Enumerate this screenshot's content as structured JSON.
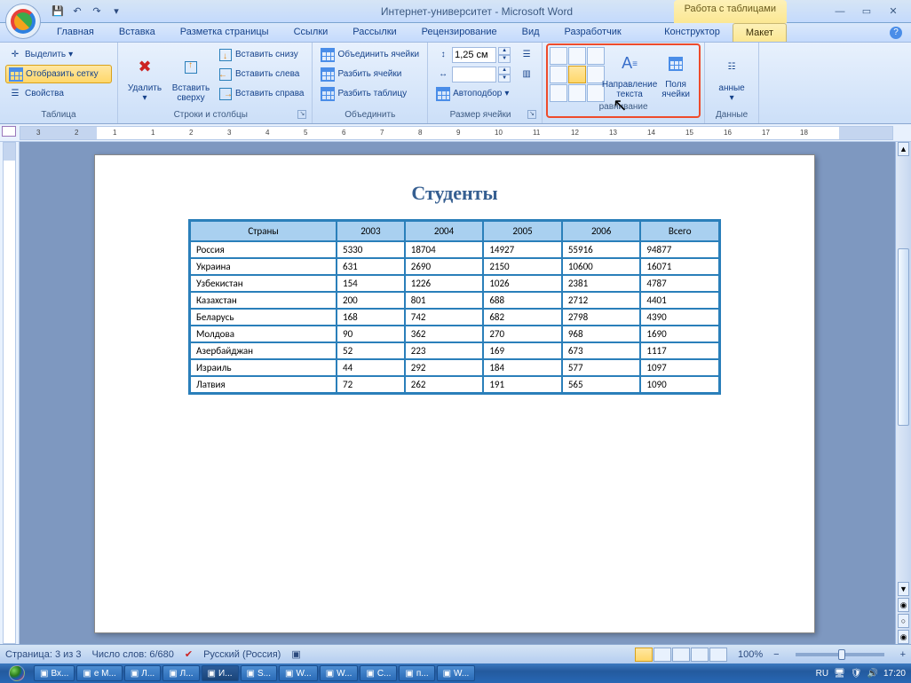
{
  "title": "Интернет-университет - Microsoft Word",
  "context_title": "Работа с таблицами",
  "tabs": [
    "Главная",
    "Вставка",
    "Разметка страницы",
    "Ссылки",
    "Рассылки",
    "Рецензирование",
    "Вид",
    "Разработчик"
  ],
  "context_tabs": [
    "Конструктор",
    "Макет"
  ],
  "active_context_tab": "Макет",
  "ribbon": {
    "table": {
      "label": "Таблица",
      "select": "Выделить",
      "grid": "Отобразить сетку",
      "props": "Свойства"
    },
    "rowscols": {
      "label": "Строки и столбцы",
      "delete": "Удалить",
      "insert_top": "Вставить сверху",
      "insert_bottom": "Вставить снизу",
      "insert_left": "Вставить слева",
      "insert_right": "Вставить справа"
    },
    "merge": {
      "label": "Объединить",
      "merge": "Объединить ячейки",
      "split": "Разбить ячейки",
      "split_table": "Разбить таблицу"
    },
    "cellsize": {
      "label": "Размер ячейки",
      "height": "1,25 см",
      "width": "",
      "autofit": "Автоподбор"
    },
    "align": {
      "label": "равнивание",
      "textdir": "Направление текста",
      "margins": "Поля ячейки"
    },
    "data": {
      "label": "Данные",
      "btn": "анные"
    }
  },
  "doc": {
    "title": "Студенты",
    "headers": [
      "Страны",
      "2003",
      "2004",
      "2005",
      "Всего"
    ],
    "header_mid": "2006",
    "rows": [
      [
        "Россия",
        "5330",
        "18704",
        "14927",
        "55916",
        "94877"
      ],
      [
        "Украина",
        "631",
        "2690",
        "2150",
        "10600",
        "16071"
      ],
      [
        "Узбекистан",
        "154",
        "1226",
        "1026",
        "2381",
        "4787"
      ],
      [
        "Казахстан",
        "200",
        "801",
        "688",
        "2712",
        "4401"
      ],
      [
        "Беларусь",
        "168",
        "742",
        "682",
        "2798",
        "4390"
      ],
      [
        "Молдова",
        "90",
        "362",
        "270",
        "968",
        "1690"
      ],
      [
        "Азербайджан",
        "52",
        "223",
        "169",
        "673",
        "1117"
      ],
      [
        "Израиль",
        "44",
        "292",
        "184",
        "577",
        "1097"
      ],
      [
        "Латвия",
        "72",
        "262",
        "191",
        "565",
        "1090"
      ]
    ]
  },
  "ruler_nums": [
    "3",
    "2",
    "1",
    "1",
    "2",
    "3",
    "4",
    "5",
    "6",
    "7",
    "8",
    "9",
    "10",
    "11",
    "12",
    "13",
    "14",
    "15",
    "16",
    "17",
    "18"
  ],
  "status": {
    "page": "Страница: 3 из 3",
    "words": "Число слов: 6/680",
    "lang": "Русский (Россия)",
    "zoom": "100%"
  },
  "taskbar": {
    "items": [
      "Вх...",
      "e M...",
      "Л...",
      "Л...",
      "И...",
      "S...",
      "W...",
      "W...",
      "C...",
      "п...",
      "W..."
    ],
    "lang": "RU",
    "clock": "17:20"
  }
}
